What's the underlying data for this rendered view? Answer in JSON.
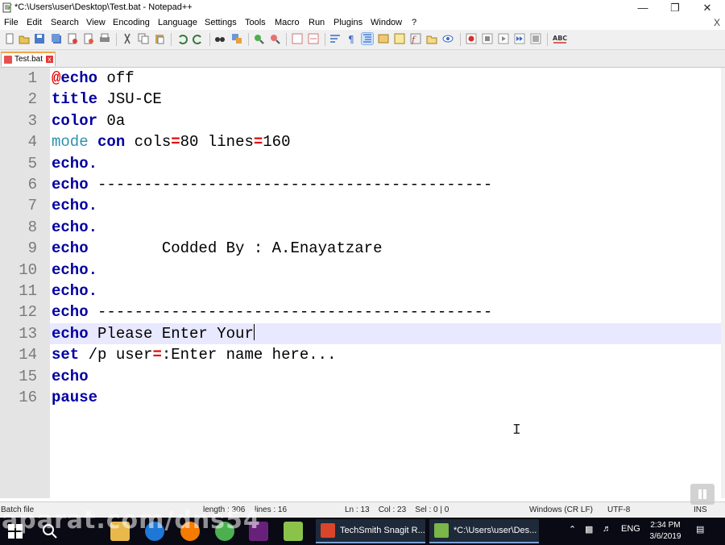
{
  "window": {
    "title": "*C:\\Users\\user\\Desktop\\Test.bat - Notepad++"
  },
  "menu": [
    "File",
    "Edit",
    "Search",
    "View",
    "Encoding",
    "Language",
    "Settings",
    "Tools",
    "Macro",
    "Run",
    "Plugins",
    "Window",
    "?"
  ],
  "menu_close": "X",
  "tab": {
    "label": "Test.bat",
    "close": "x"
  },
  "editor": {
    "lines": [
      {
        "n": "1",
        "parts": [
          [
            "op",
            "@"
          ],
          [
            "kw",
            "echo"
          ],
          [
            "txt",
            " off"
          ]
        ]
      },
      {
        "n": "2",
        "parts": [
          [
            "kw",
            "title"
          ],
          [
            "txt",
            " JSU-CE"
          ]
        ]
      },
      {
        "n": "3",
        "parts": [
          [
            "kw",
            "color"
          ],
          [
            "txt",
            " 0a"
          ]
        ]
      },
      {
        "n": "4",
        "parts": [
          [
            "cm",
            "mode"
          ],
          [
            "txt",
            " "
          ],
          [
            "kw",
            "con"
          ],
          [
            "txt",
            " cols"
          ],
          [
            "op",
            "="
          ],
          [
            "txt",
            "80 lines"
          ],
          [
            "op",
            "="
          ],
          [
            "txt",
            "160"
          ]
        ]
      },
      {
        "n": "5",
        "parts": [
          [
            "kw",
            "echo."
          ]
        ]
      },
      {
        "n": "6",
        "parts": [
          [
            "kw",
            "echo"
          ],
          [
            "txt",
            " -------------------------------------------"
          ]
        ]
      },
      {
        "n": "7",
        "parts": [
          [
            "kw",
            "echo."
          ]
        ]
      },
      {
        "n": "8",
        "parts": [
          [
            "kw",
            "echo."
          ]
        ]
      },
      {
        "n": "9",
        "parts": [
          [
            "kw",
            "echo"
          ],
          [
            "txt",
            "        Codded By : A.Enayatzare"
          ]
        ]
      },
      {
        "n": "10",
        "parts": [
          [
            "kw",
            "echo."
          ]
        ]
      },
      {
        "n": "11",
        "parts": [
          [
            "kw",
            "echo."
          ]
        ]
      },
      {
        "n": "12",
        "parts": [
          [
            "kw",
            "echo"
          ],
          [
            "txt",
            " -------------------------------------------"
          ]
        ]
      },
      {
        "n": "13",
        "parts": [
          [
            "kw",
            "echo"
          ],
          [
            "txt",
            " Please Enter Your"
          ]
        ],
        "current": true
      },
      {
        "n": "14",
        "parts": [
          [
            "kw",
            "set"
          ],
          [
            "txt",
            " /p user"
          ],
          [
            "op",
            "="
          ],
          [
            "txt",
            ":Enter name here..."
          ]
        ]
      },
      {
        "n": "15",
        "parts": [
          [
            "kw",
            "echo"
          ]
        ]
      },
      {
        "n": "16",
        "parts": [
          [
            "kw",
            "pause"
          ]
        ]
      }
    ]
  },
  "status": {
    "filetype": "Batch file",
    "length": "length : 306",
    "lines": "lines : 16",
    "position": "Ln : 13    Col : 23    Sel : 0 | 0",
    "eol": "Windows (CR LF)",
    "encoding": "UTF-8",
    "mode": "INS"
  },
  "taskbar": {
    "items": [
      {
        "label": "TechSmith Snagit R...",
        "color": "#d9452b"
      },
      {
        "label": "*C:\\Users\\user\\Des...",
        "color": "#7ab648"
      }
    ],
    "lang": "ENG",
    "time": "2:34 PM",
    "date": "3/6/2019"
  },
  "watermark": "aparat.com/dns54",
  "colors": {
    "keyword": "#0000a0",
    "command": "#2b91af",
    "operator": "#e00000",
    "tab_accent": "#f7a24a"
  }
}
